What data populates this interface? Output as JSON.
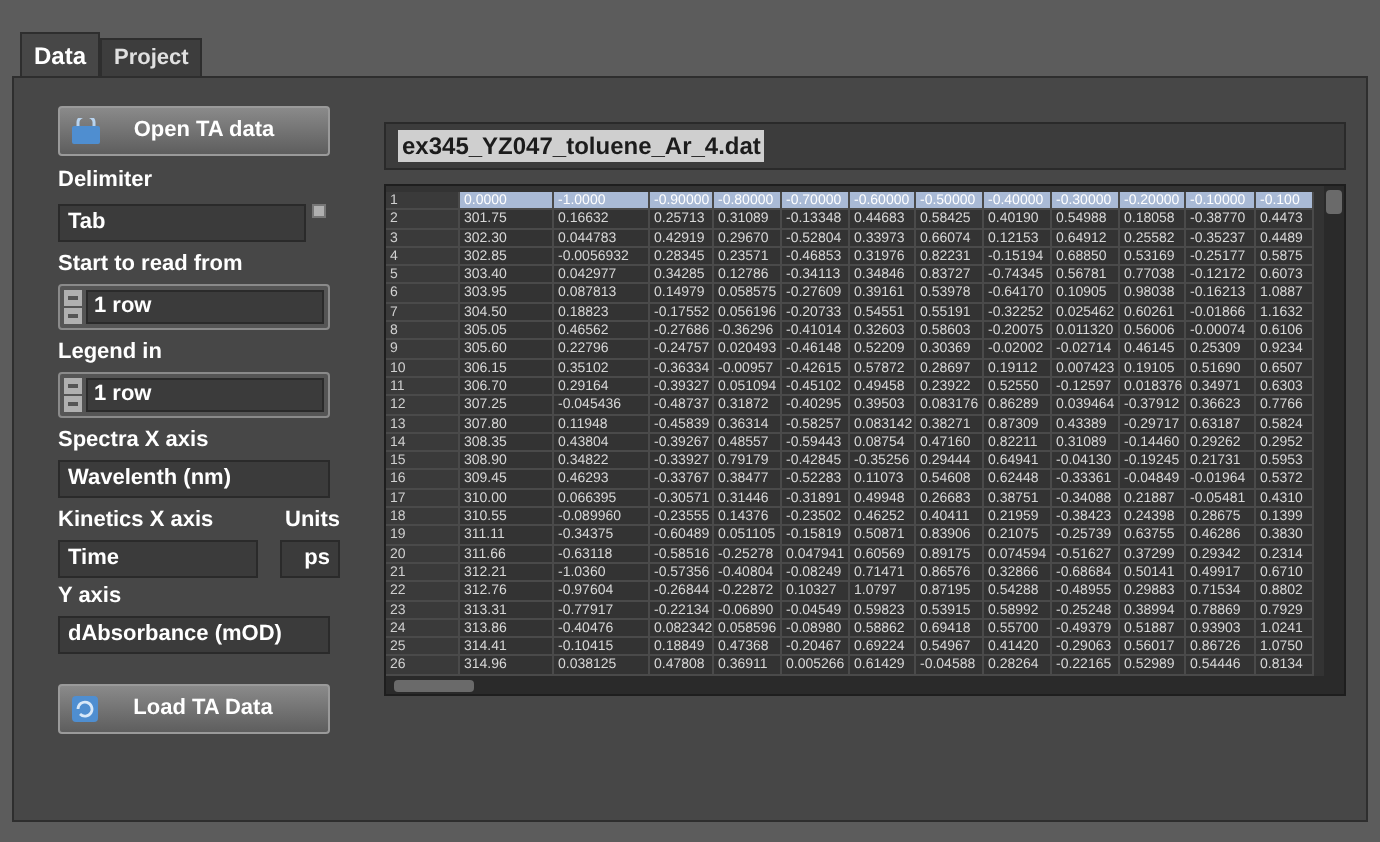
{
  "tabs": [
    {
      "label": "Data",
      "selected": true
    },
    {
      "label": "Project",
      "selected": false
    }
  ],
  "open_button": {
    "label": "Open TA data"
  },
  "delimiter": {
    "label": "Delimiter",
    "value": "Tab"
  },
  "start_row": {
    "label": "Start to read from",
    "value": "1  row"
  },
  "legend_row": {
    "label": "Legend in",
    "value": "1  row"
  },
  "spectra_x_axis": {
    "label": "Spectra X axis",
    "value": "Wavelenth (nm)"
  },
  "kinetics_x_axis": {
    "label": "Kinetics X axis",
    "value": "Time"
  },
  "units": {
    "label": "Units",
    "value": "ps"
  },
  "y_axis": {
    "label": "Y axis",
    "value": "dAbsorbance (mOD)"
  },
  "load_button": {
    "label": "Load TA Data"
  },
  "file_name": "ex345_YZ047_toluene_Ar_4.dat",
  "table": {
    "rows": [
      {
        "selected": true,
        "cells": [
          "1",
          "0.0000",
          "-1.0000",
          "-0.90000",
          "-0.80000",
          "-0.70000",
          "-0.60000",
          "-0.50000",
          "-0.40000",
          "-0.30000",
          "-0.20000",
          "-0.10000",
          "-0.100"
        ]
      },
      {
        "selected": false,
        "cells": [
          "2",
          "301.75",
          "0.16632",
          "0.25713",
          "0.31089",
          "-0.13348",
          "0.44683",
          "0.58425",
          "0.40190",
          "0.54988",
          "0.18058",
          "-0.38770",
          "0.4473"
        ]
      },
      {
        "selected": false,
        "cells": [
          "3",
          "302.30",
          "0.044783",
          "0.42919",
          "0.29670",
          "-0.52804",
          "0.33973",
          "0.66074",
          "0.12153",
          "0.64912",
          "0.25582",
          "-0.35237",
          "0.4489"
        ]
      },
      {
        "selected": false,
        "cells": [
          "4",
          "302.85",
          "-0.0056932",
          "0.28345",
          "0.23571",
          "-0.46853",
          "0.31976",
          "0.82231",
          "-0.15194",
          "0.68850",
          "0.53169",
          "-0.25177",
          "0.5875"
        ]
      },
      {
        "selected": false,
        "cells": [
          "5",
          "303.40",
          "0.042977",
          "0.34285",
          "0.12786",
          "-0.34113",
          "0.34846",
          "0.83727",
          "-0.74345",
          "0.56781",
          "0.77038",
          "-0.12172",
          "0.6073"
        ]
      },
      {
        "selected": false,
        "cells": [
          "6",
          "303.95",
          "0.087813",
          "0.14979",
          "0.058575",
          "-0.27609",
          "0.39161",
          "0.53978",
          "-0.64170",
          "0.10905",
          "0.98038",
          "-0.16213",
          "1.0887"
        ]
      },
      {
        "selected": false,
        "cells": [
          "7",
          "304.50",
          "0.18823",
          "-0.17552",
          "0.056196",
          "-0.20733",
          "0.54551",
          "0.55191",
          "-0.32252",
          "0.025462",
          "0.60261",
          "-0.01866",
          "1.1632"
        ]
      },
      {
        "selected": false,
        "cells": [
          "8",
          "305.05",
          "0.46562",
          "-0.27686",
          "-0.36296",
          "-0.41014",
          "0.32603",
          "0.58603",
          "-0.20075",
          "0.011320",
          "0.56006",
          "-0.00074",
          "0.6106"
        ]
      },
      {
        "selected": false,
        "cells": [
          "9",
          "305.60",
          "0.22796",
          "-0.24757",
          "0.020493",
          "-0.46148",
          "0.52209",
          "0.30369",
          "-0.02002",
          "-0.02714",
          "0.46145",
          "0.25309",
          "0.9234"
        ]
      },
      {
        "selected": false,
        "cells": [
          "10",
          "306.15",
          "0.35102",
          "-0.36334",
          "-0.00957",
          "-0.42615",
          "0.57872",
          "0.28697",
          "0.19112",
          "0.007423",
          "0.19105",
          "0.51690",
          "0.6507"
        ]
      },
      {
        "selected": false,
        "cells": [
          "11",
          "306.70",
          "0.29164",
          "-0.39327",
          "0.051094",
          "-0.45102",
          "0.49458",
          "0.23922",
          "0.52550",
          "-0.12597",
          "0.018376",
          "0.34971",
          "0.6303"
        ]
      },
      {
        "selected": false,
        "cells": [
          "12",
          "307.25",
          "-0.045436",
          "-0.48737",
          "0.31872",
          "-0.40295",
          "0.39503",
          "0.083176",
          "0.86289",
          "0.039464",
          "-0.37912",
          "0.36623",
          "0.7766"
        ]
      },
      {
        "selected": false,
        "cells": [
          "13",
          "307.80",
          "0.11948",
          "-0.45839",
          "0.36314",
          "-0.58257",
          "0.083142",
          "0.38271",
          "0.87309",
          "0.43389",
          "-0.29717",
          "0.63187",
          "0.5824"
        ]
      },
      {
        "selected": false,
        "cells": [
          "14",
          "308.35",
          "0.43804",
          "-0.39267",
          "0.48557",
          "-0.59443",
          "0.08754",
          "0.47160",
          "0.82211",
          "0.31089",
          "-0.14460",
          "0.29262",
          "0.2952"
        ]
      },
      {
        "selected": false,
        "cells": [
          "15",
          "308.90",
          "0.34822",
          "-0.33927",
          "0.79179",
          "-0.42845",
          "-0.35256",
          "0.29444",
          "0.64941",
          "-0.04130",
          "-0.19245",
          "0.21731",
          "0.5953"
        ]
      },
      {
        "selected": false,
        "cells": [
          "16",
          "309.45",
          "0.46293",
          "-0.33767",
          "0.38477",
          "-0.52283",
          "0.11073",
          "0.54608",
          "0.62448",
          "-0.33361",
          "-0.04849",
          "-0.01964",
          "0.5372"
        ]
      },
      {
        "selected": false,
        "cells": [
          "17",
          "310.00",
          "0.066395",
          "-0.30571",
          "0.31446",
          "-0.31891",
          "0.49948",
          "0.26683",
          "0.38751",
          "-0.34088",
          "0.21887",
          "-0.05481",
          "0.4310"
        ]
      },
      {
        "selected": false,
        "cells": [
          "18",
          "310.55",
          "-0.089960",
          "-0.23555",
          "0.14376",
          "-0.23502",
          "0.46252",
          "0.40411",
          "0.21959",
          "-0.38423",
          "0.24398",
          "0.28675",
          "0.1399"
        ]
      },
      {
        "selected": false,
        "cells": [
          "19",
          "311.11",
          "-0.34375",
          "-0.60489",
          "0.051105",
          "-0.15819",
          "0.50871",
          "0.83906",
          "0.21075",
          "-0.25739",
          "0.63755",
          "0.46286",
          "0.3830"
        ]
      },
      {
        "selected": false,
        "cells": [
          "20",
          "311.66",
          "-0.63118",
          "-0.58516",
          "-0.25278",
          "0.047941",
          "0.60569",
          "0.89175",
          "0.074594",
          "-0.51627",
          "0.37299",
          "0.29342",
          "0.2314"
        ]
      },
      {
        "selected": false,
        "cells": [
          "21",
          "312.21",
          "-1.0360",
          "-0.57356",
          "-0.40804",
          "-0.08249",
          "0.71471",
          "0.86576",
          "0.32866",
          "-0.68684",
          "0.50141",
          "0.49917",
          "0.6710"
        ]
      },
      {
        "selected": false,
        "cells": [
          "22",
          "312.76",
          "-0.97604",
          "-0.26844",
          "-0.22872",
          "0.10327",
          "1.0797",
          "0.87195",
          "0.54288",
          "-0.48955",
          "0.29883",
          "0.71534",
          "0.8802"
        ]
      },
      {
        "selected": false,
        "cells": [
          "23",
          "313.31",
          "-0.77917",
          "-0.22134",
          "-0.06890",
          "-0.04549",
          "0.59823",
          "0.53915",
          "0.58992",
          "-0.25248",
          "0.38994",
          "0.78869",
          "0.7929"
        ]
      },
      {
        "selected": false,
        "cells": [
          "24",
          "313.86",
          "-0.40476",
          "0.082342",
          "0.058596",
          "-0.08980",
          "0.58862",
          "0.69418",
          "0.55700",
          "-0.49379",
          "0.51887",
          "0.93903",
          "1.0241"
        ]
      },
      {
        "selected": false,
        "cells": [
          "25",
          "314.41",
          "-0.10415",
          "0.18849",
          "0.47368",
          "-0.20467",
          "0.69224",
          "0.54967",
          "0.41420",
          "-0.29063",
          "0.56017",
          "0.86726",
          "1.0750"
        ]
      },
      {
        "selected": false,
        "cells": [
          "26",
          "314.96",
          "0.038125",
          "0.47808",
          "0.36911",
          "0.005266",
          "0.61429",
          "-0.04588",
          "0.28264",
          "-0.22165",
          "0.52989",
          "0.54446",
          "0.8134"
        ]
      }
    ]
  }
}
